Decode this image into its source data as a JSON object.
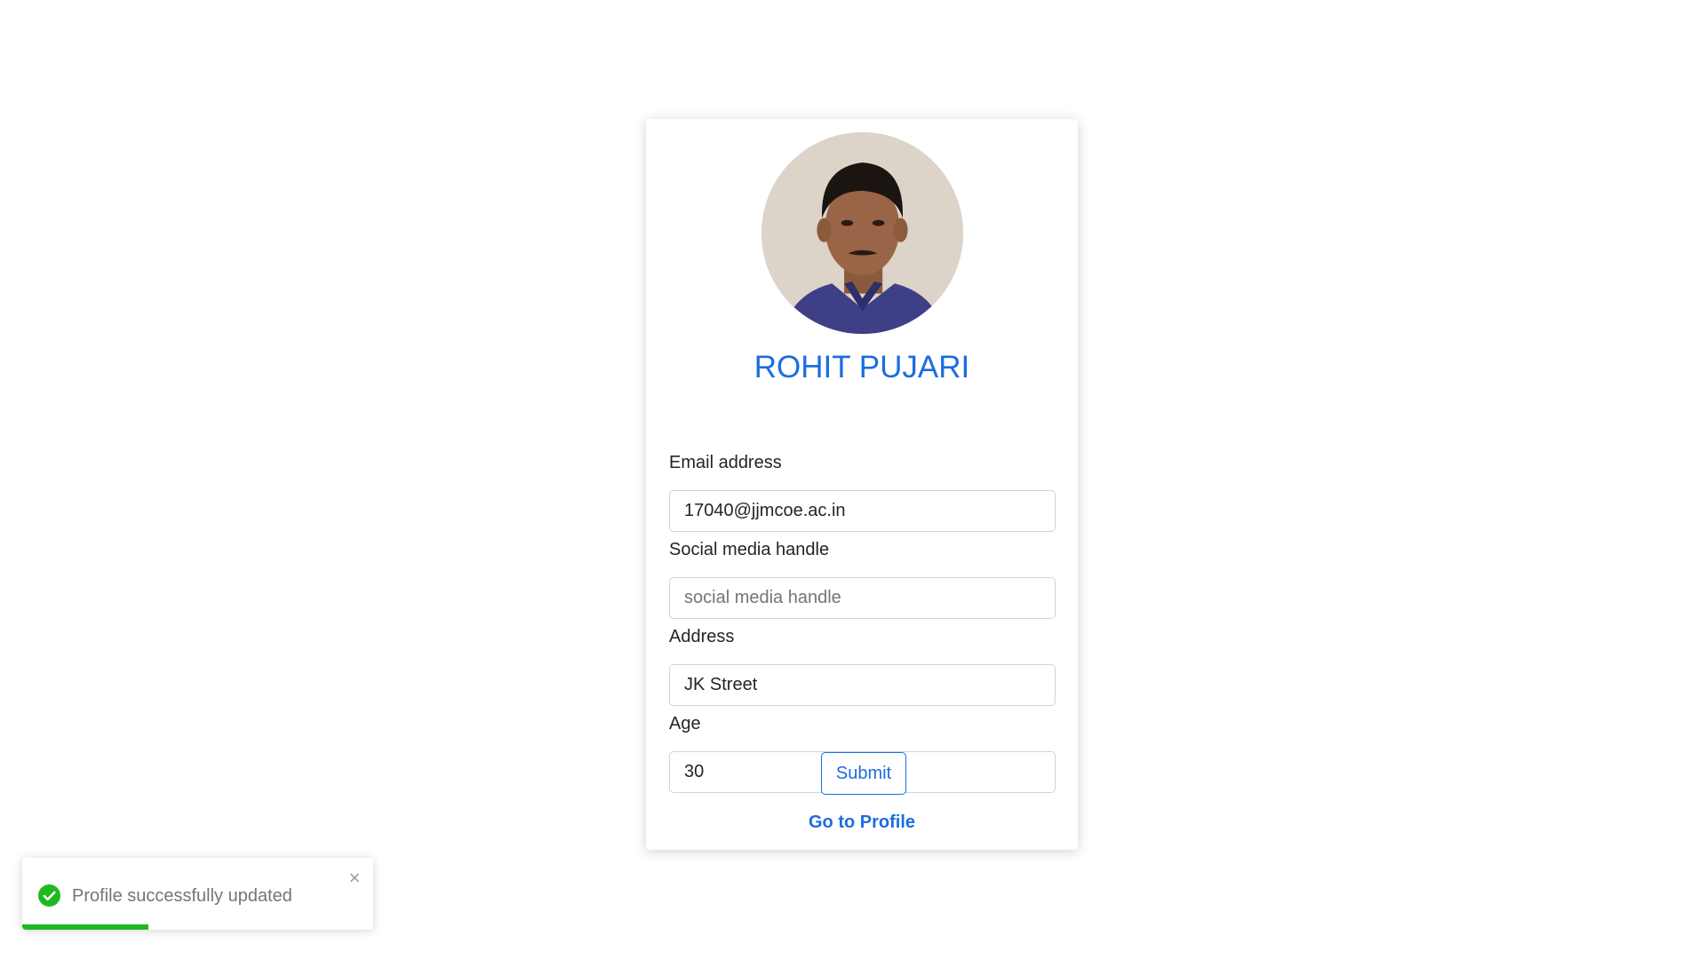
{
  "profile": {
    "name": "ROHIT PUJARI",
    "avatar_icon": "profile-photo"
  },
  "form": {
    "email_label": "Email address",
    "email_value": "17040@jjmcoe.ac.in",
    "social_label": "Social media handle",
    "social_value": "",
    "social_placeholder": "social media handle",
    "address_label": "Address",
    "address_value": "JK Street",
    "age_label": "Age",
    "age_value": "30",
    "submit_label": "Submit",
    "profile_link_label": "Go to Profile"
  },
  "toast": {
    "message": "Profile successfully updated",
    "icon": "check-circle-icon",
    "close_icon": "close-icon",
    "progress_remaining": 0.36,
    "color": "#1fb91f"
  },
  "colors": {
    "accent": "#1c6de0",
    "success": "#1fb91f"
  }
}
